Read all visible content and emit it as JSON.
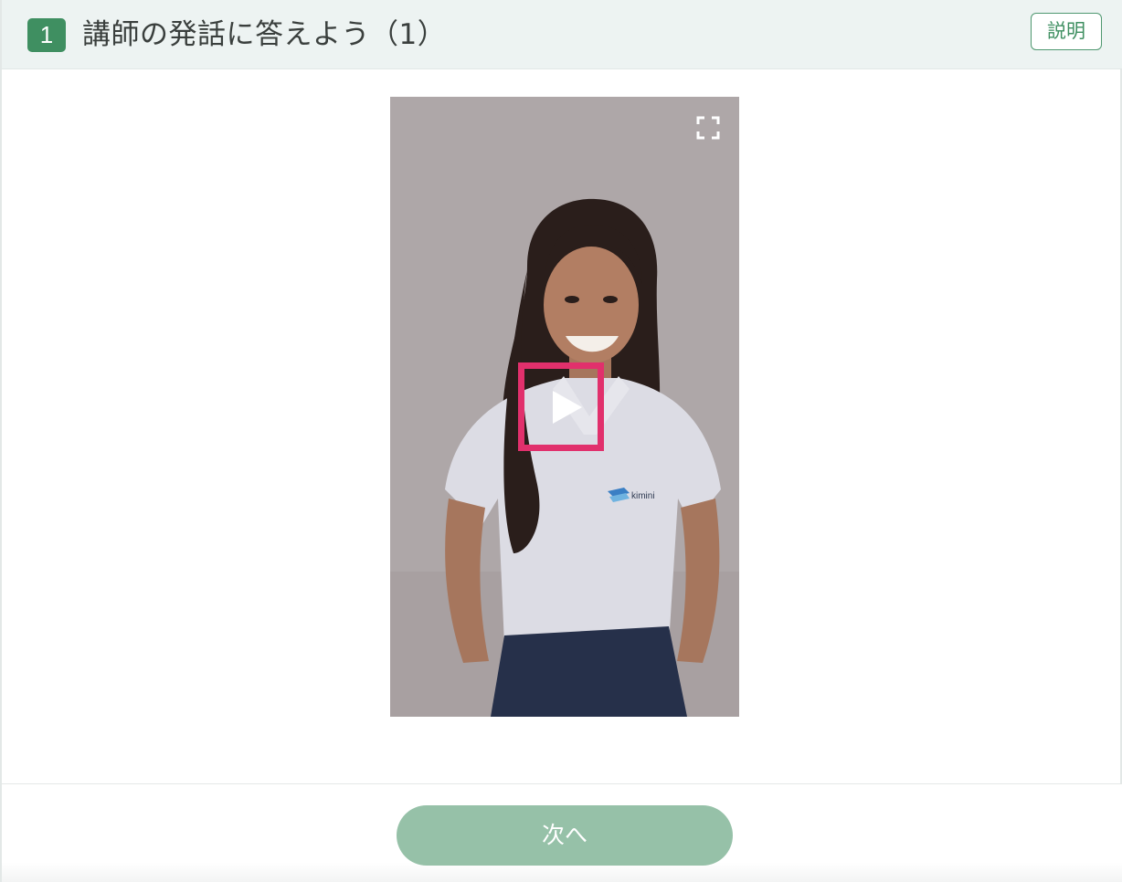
{
  "header": {
    "step_number": "1",
    "title": "講師の発話に答えよう（1）",
    "explain_label": "説明"
  },
  "video": {
    "shirt_logo_text": "kimini",
    "icons": {
      "fullscreen": "fullscreen-icon",
      "play": "play-icon"
    },
    "play_highlight_color": "#e1306c"
  },
  "footer": {
    "next_label": "次へ"
  },
  "colors": {
    "accent": "#3f8f61",
    "header_bg": "#edf3f2",
    "next_button_bg": "#96c1a8"
  }
}
